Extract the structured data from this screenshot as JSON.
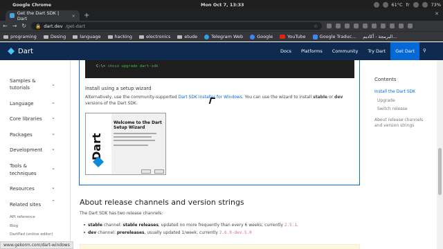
{
  "os": {
    "app_name": "Google Chrome",
    "clock": "Mon Oct  7, 13:33",
    "temperature": "61°C",
    "lang": "fr",
    "battery": "73%"
  },
  "browser": {
    "tab_title": "Get the Dart SDK | Dart",
    "url_host": "dart.dev",
    "url_path": "/get-dart",
    "bookmarks": [
      "programing",
      "Desing",
      "language",
      "hacking",
      "electronics",
      "etude",
      "Telegram Web",
      "Google",
      "YouTube",
      "Google Traduc...",
      "البرمجة - أكاديم..."
    ]
  },
  "site": {
    "logo": "Dart",
    "nav": [
      "Docs",
      "Platforms",
      "Community",
      "Try Dart",
      "Get Dart"
    ]
  },
  "sidebar": {
    "items": [
      "Samples & tutorials",
      "Language",
      "Core libraries",
      "Packages",
      "Development",
      "Tools & techniques",
      "Resources",
      "Related sites"
    ],
    "related_links": [
      "API reference",
      "Blog",
      "DartPad (online editor)"
    ]
  },
  "main": {
    "command": "C:\\> choco upgrade dart-sdk",
    "command_prompt": "C:\\>",
    "command_text": "choco upgrade dart-sdk",
    "setup_heading": "Install using a setup wizard",
    "setup_p1": "Alternatively, use the community-supported ",
    "setup_link": "Dart SDK installer for Windows.",
    "setup_p2": " You can use the wizard to install ",
    "stable": "stable",
    "or": " or ",
    "dev": "dev",
    "setup_p3": " versions of the Dart SDK.",
    "installer_title": "Welcome to the Dart Setup Wizard",
    "installer_logo": "Dart",
    "h2": "About release channels and version strings",
    "p2": "The Dart SDK has two release channels:",
    "li1": {
      "name": "stable",
      "mid": " channel: ",
      "bold": "stable releases",
      "rest": ", updated no more frequently than every 6 weeks; currently ",
      "ver": "2.5.1",
      "end": "."
    },
    "li2": {
      "name": "dev",
      "mid": " channel: ",
      "bold": "prereleases",
      "rest": ", usually updated 1/week; currently ",
      "ver": "2.6.0-dev.5.0",
      "end": ""
    }
  },
  "toc": {
    "heading": "Contents",
    "links": [
      "Install the Dart SDK",
      "Upgrade",
      "Switch release",
      "About release channels and version strings"
    ]
  },
  "status_url": "www.gekorm.com/dart-windows"
}
